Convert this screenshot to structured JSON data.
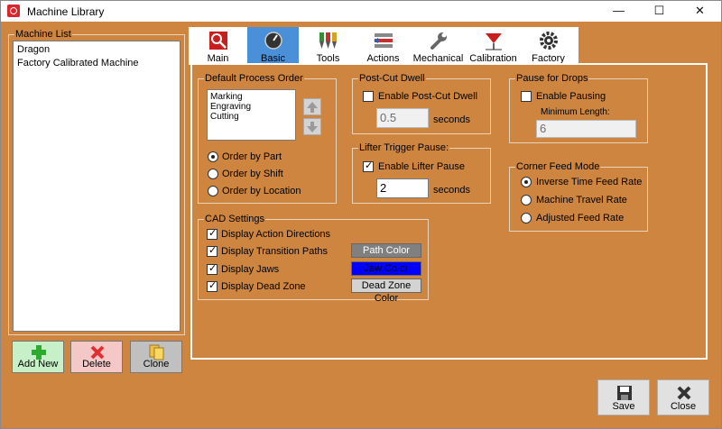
{
  "window": {
    "title": "Machine Library"
  },
  "machine_list": {
    "label": "Machine List",
    "items": [
      "Dragon",
      "Factory Calibrated Machine"
    ]
  },
  "side_buttons": {
    "add_new": "Add New",
    "delete": "Delete",
    "clone": "Clone"
  },
  "tabs": [
    "Main",
    "Basic",
    "Tools",
    "Actions",
    "Mechanical",
    "Calibration",
    "Factory"
  ],
  "active_tab": "Basic",
  "default_process_order": {
    "label": "Default Process Order",
    "items": [
      "Marking",
      "Engraving",
      "Cutting"
    ],
    "options": [
      "Order by Part",
      "Order by Shift",
      "Order by Location"
    ],
    "selected": "Order by Part"
  },
  "post_cut_dwell": {
    "label": "Post-Cut Dwell",
    "enable_label": "Enable Post-Cut Dwell",
    "enabled": false,
    "value": "0.5",
    "unit": "seconds"
  },
  "lifter_trigger_pause": {
    "label": "Lifter Trigger Pause:",
    "enable_label": "Enable Lifter Pause",
    "enabled": true,
    "value": "2",
    "unit": "seconds"
  },
  "pause_for_drops": {
    "label": "Pause for Drops",
    "enable_label": "Enable Pausing",
    "enabled": false,
    "min_length_label": "Minimum Length:",
    "value": "6"
  },
  "corner_feed_mode": {
    "label": "Corner Feed Mode",
    "options": [
      "Inverse Time Feed Rate",
      "Machine Travel Rate",
      "Adjusted Feed Rate"
    ],
    "selected": "Inverse Time Feed Rate"
  },
  "cad_settings": {
    "label": "CAD Settings",
    "options": [
      "Display Action Directions",
      "Display Transition Paths",
      "Display Jaws",
      "Display Dead Zone"
    ],
    "path_color_label": "Path Color",
    "jaw_color_label": "Jaw Color",
    "dead_zone_color_label": "Dead Zone Color",
    "path_color": "#808080",
    "jaw_color": "#0000ff",
    "dead_zone_color": "#d3d3d3"
  },
  "bottom_buttons": {
    "save": "Save",
    "close": "Close"
  },
  "colors": {
    "background": "#cd853f",
    "active_tab": "#4a90d9",
    "add_new": "#c8f0c8",
    "delete": "#f5c8c8",
    "clone": "#c0c0c0"
  }
}
